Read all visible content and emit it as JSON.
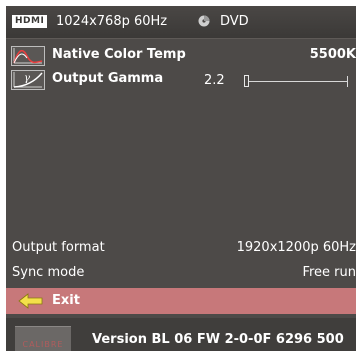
{
  "header": {
    "hdmi_badge": "HDMI",
    "resolution": "1024x768p 60Hz",
    "source_icon": "disc-icon",
    "source": "DVD"
  },
  "menu": {
    "items": [
      {
        "label": "Native Color Temp",
        "value": "5500K",
        "icon": "color-temp-curve-icon"
      },
      {
        "label": "Output Gamma",
        "value": "2.2",
        "icon": "gamma-curve-icon",
        "slider_fraction": 0.0
      }
    ]
  },
  "info": {
    "rows": [
      {
        "label": "Output format",
        "value": "1920x1200p 60Hz"
      },
      {
        "label": "Sync mode",
        "value": "Free run"
      }
    ]
  },
  "exit": {
    "label": "Exit",
    "icon": "left-arrow-icon"
  },
  "footer": {
    "logo_text": "CALIBRE",
    "version": "Version BL 06 FW 2-0-0F  6296 500"
  },
  "colors": {
    "background": "#4d4a48",
    "exit_highlight": "#c7787a",
    "footer": "#403e3c"
  }
}
